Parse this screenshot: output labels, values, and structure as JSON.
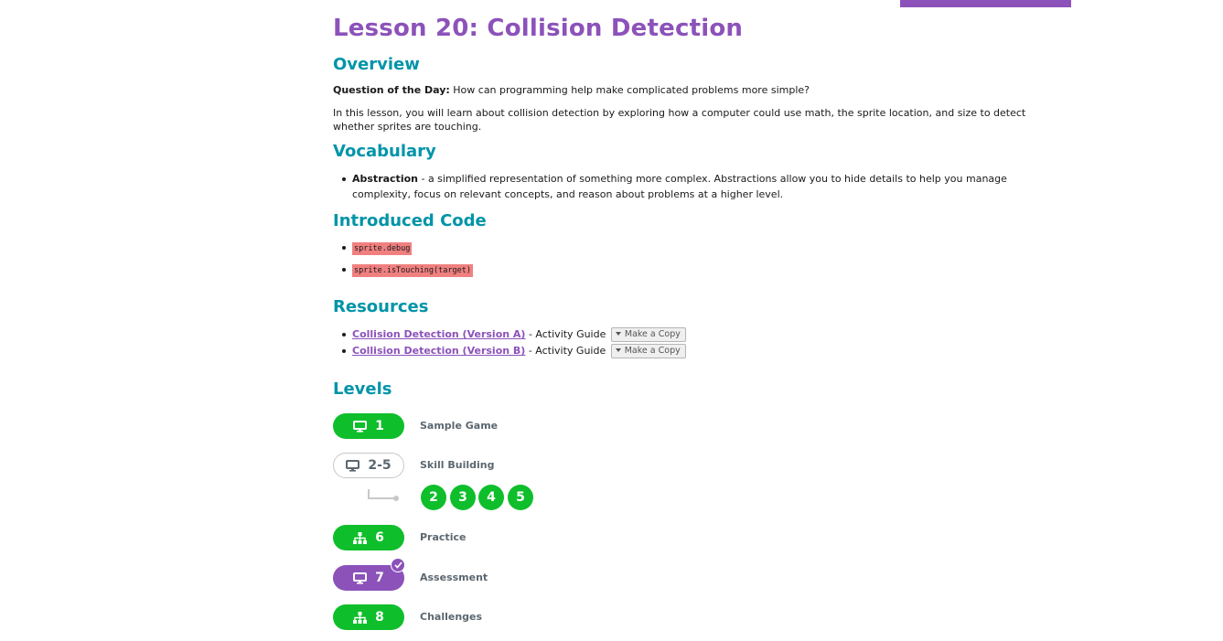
{
  "lesson": {
    "title": "Lesson 20: Collision Detection"
  },
  "overview": {
    "heading": "Overview",
    "qotd_label": "Question of the Day:",
    "qotd_text": " How can programming help make complicated problems more simple?",
    "description": "In this lesson, you will learn about collision detection by exploring how a computer could use math, the sprite location, and size to detect whether sprites are touching."
  },
  "vocabulary": {
    "heading": "Vocabulary",
    "items": [
      {
        "term": "Abstraction",
        "definition": " - a simplified representation of something more complex. Abstractions allow you to hide details to help you manage complexity, focus on relevant concepts, and reason about problems at a higher level."
      }
    ]
  },
  "introduced_code": {
    "heading": "Introduced Code",
    "items": [
      "sprite.debug",
      "sprite.isTouching(target)"
    ]
  },
  "resources": {
    "heading": "Resources",
    "items": [
      {
        "link": "Collision Detection (Version A)",
        "suffix": " - Activity Guide ",
        "button": "Make a Copy"
      },
      {
        "link": "Collision Detection (Version B)",
        "suffix": " - Activity Guide ",
        "button": "Make a Copy"
      }
    ]
  },
  "levels": {
    "heading": "Levels",
    "items": [
      {
        "label": "1",
        "name": "Sample Game",
        "icon": "desktop-icon",
        "style": "green",
        "color": "#0fbe2b"
      },
      {
        "label": "2-5",
        "name": "Skill Building",
        "icon": "desktop-icon",
        "style": "outline",
        "sub_levels": [
          "2",
          "3",
          "4",
          "5"
        ]
      },
      {
        "label": "6",
        "name": "Practice",
        "icon": "sitemap-icon",
        "style": "green"
      },
      {
        "label": "7",
        "name": "Assessment",
        "icon": "desktop-icon",
        "style": "purple",
        "color": "#8c52ba",
        "badge": "check-icon"
      },
      {
        "label": "8",
        "name": "Challenges",
        "icon": "sitemap-icon",
        "style": "green"
      }
    ]
  },
  "colors": {
    "accent": "#8c52ba",
    "heading": "#0094a8",
    "level_green": "#0fbe2b",
    "code_bg": "#f08080"
  }
}
